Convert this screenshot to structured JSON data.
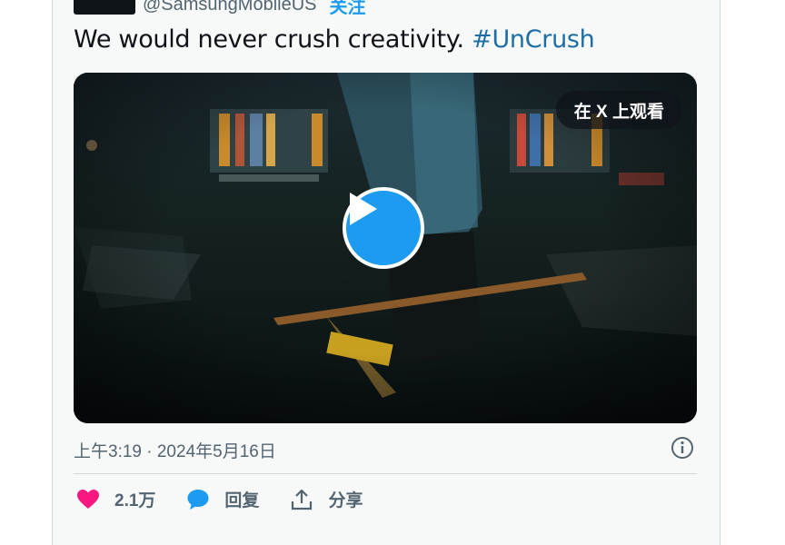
{
  "tweet": {
    "handle": "@SamsungMobileUS",
    "follow_label": "关注",
    "text": "We would never crush creativity. ",
    "hashtag": "#UnCrush",
    "timestamp": "上午3:19 · 2024年5月16日"
  },
  "media": {
    "watch_on_x_label": "在 X 上观看"
  },
  "actions": {
    "like_count": "2.1万",
    "reply_label": "回复",
    "share_label": "分享"
  },
  "colors": {
    "accent": "#1d9bf0",
    "like": "#f91880",
    "hashtag": "#1d6fa5",
    "muted": "#536471"
  },
  "icons": [
    "heart-icon",
    "reply-bubble-icon",
    "share-icon",
    "info-icon",
    "play-icon"
  ]
}
